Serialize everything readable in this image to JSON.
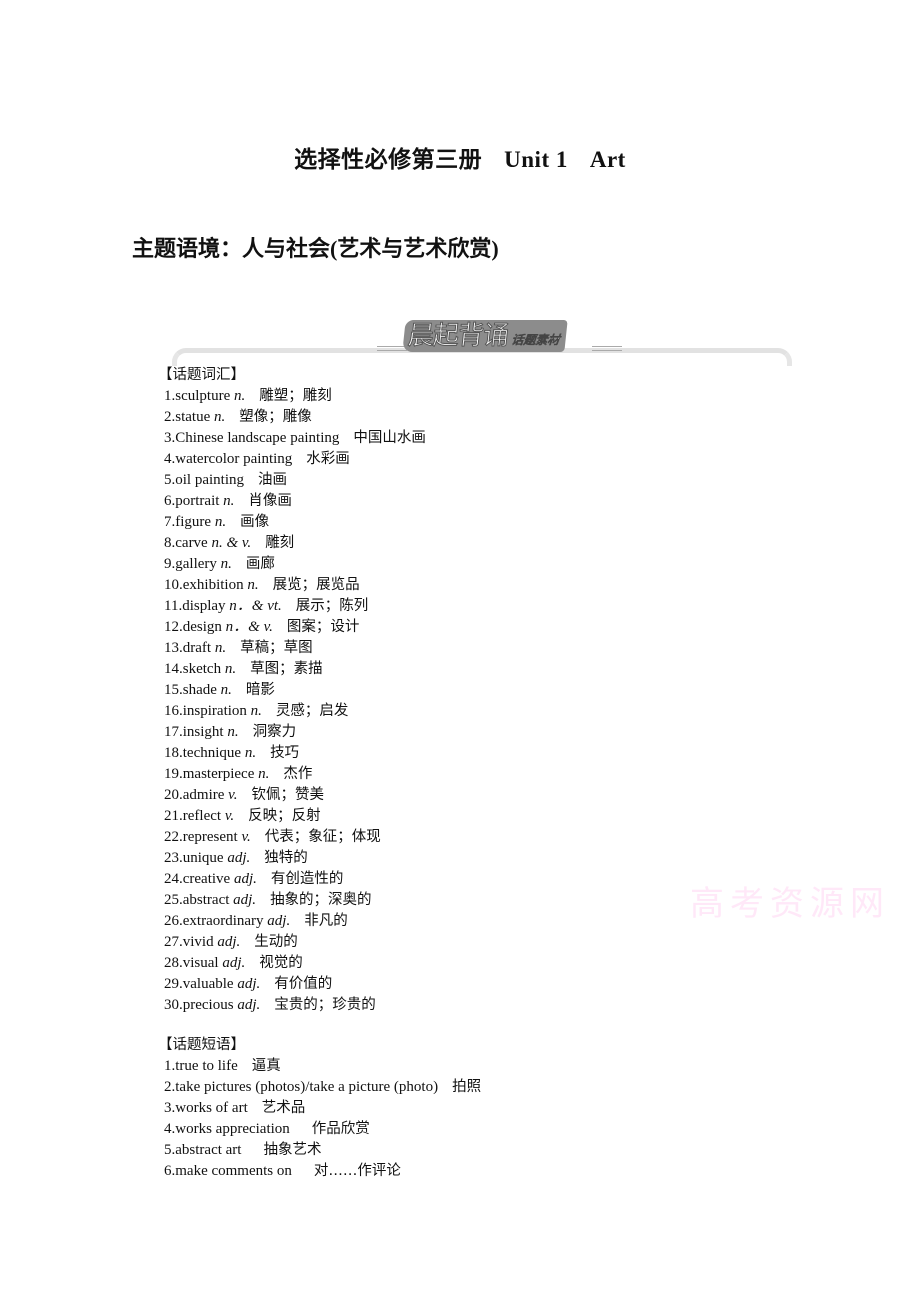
{
  "header": {
    "title_cn": "选择性必修第三册",
    "title_unit": "Unit 1",
    "title_topic": "Art",
    "theme": "主题语境：人与社会(艺术与艺术欣赏)"
  },
  "banner": {
    "main": "晨起背诵",
    "sub": "话题素材"
  },
  "vocabulary": {
    "heading": "【话题词汇】",
    "items": [
      {
        "num": "1.",
        "word": "sculpture",
        "pos": "n.",
        "meaning": "雕塑；雕刻"
      },
      {
        "num": "2.",
        "word": "statue",
        "pos": "n.",
        "meaning": "塑像；雕像"
      },
      {
        "num": "3.",
        "word": "Chinese landscape painting",
        "pos": "",
        "meaning": "中国山水画"
      },
      {
        "num": "4.",
        "word": "watercolor painting",
        "pos": "",
        "meaning": "水彩画"
      },
      {
        "num": "5.",
        "word": "oil painting",
        "pos": "",
        "meaning": "油画"
      },
      {
        "num": "6.",
        "word": "portrait",
        "pos": "n.",
        "meaning": "肖像画"
      },
      {
        "num": "7.",
        "word": "figure",
        "pos": "n.",
        "meaning": "画像"
      },
      {
        "num": "8.",
        "word": "carve",
        "pos": "n. & v.",
        "meaning": "雕刻"
      },
      {
        "num": "9.",
        "word": "gallery",
        "pos": "n.",
        "meaning": "画廊"
      },
      {
        "num": "10.",
        "word": "exhibition",
        "pos": "n.",
        "meaning": "展览；展览品"
      },
      {
        "num": "11.",
        "word": "display",
        "pos": "n．& vt.",
        "meaning": "展示；陈列"
      },
      {
        "num": "12.",
        "word": "design",
        "pos": "n．& v.",
        "meaning": "图案；设计"
      },
      {
        "num": "13.",
        "word": "draft",
        "pos": "n.",
        "meaning": "草稿；草图"
      },
      {
        "num": "14.",
        "word": "sketch",
        "pos": "n.",
        "meaning": "草图；素描"
      },
      {
        "num": "15.",
        "word": "shade",
        "pos": "n.",
        "meaning": "暗影"
      },
      {
        "num": "16.",
        "word": "inspiration",
        "pos": "n.",
        "meaning": "灵感；启发"
      },
      {
        "num": "17.",
        "word": "insight",
        "pos": "n.",
        "meaning": "洞察力"
      },
      {
        "num": "18.",
        "word": "technique",
        "pos": "n.",
        "meaning": "技巧"
      },
      {
        "num": "19.",
        "word": "masterpiece",
        "pos": "n.",
        "meaning": "杰作"
      },
      {
        "num": "20.",
        "word": "admire",
        "pos": "v.",
        "meaning": "钦佩；赞美"
      },
      {
        "num": "21.",
        "word": "reflect",
        "pos": "v.",
        "meaning": "反映；反射"
      },
      {
        "num": "22.",
        "word": "represent",
        "pos": "v.",
        "meaning": "代表；象征；体现"
      },
      {
        "num": "23.",
        "word": "unique",
        "pos": "adj.",
        "meaning": "独特的"
      },
      {
        "num": "24.",
        "word": "creative",
        "pos": "adj.",
        "meaning": "有创造性的"
      },
      {
        "num": "25.",
        "word": "abstract",
        "pos": "adj.",
        "meaning": "抽象的；深奥的"
      },
      {
        "num": "26.",
        "word": "extraordinary",
        "pos": "adj.",
        "meaning": "非凡的"
      },
      {
        "num": "27.",
        "word": "vivid",
        "pos": "adj.",
        "meaning": "生动的"
      },
      {
        "num": "28.",
        "word": "visual",
        "pos": "adj.",
        "meaning": "视觉的"
      },
      {
        "num": "29.",
        "word": "valuable",
        "pos": "adj.",
        "meaning": "有价值的"
      },
      {
        "num": "30.",
        "word": "precious",
        "pos": "adj.",
        "meaning": "宝贵的；珍贵的"
      }
    ]
  },
  "phrases": {
    "heading": "【话题短语】",
    "items": [
      {
        "num": "1.",
        "phrase": "true to life",
        "meaning": "逼真"
      },
      {
        "num": "2.",
        "phrase": "take pictures (photos)/take a picture (photo)",
        "meaning": "拍照"
      },
      {
        "num": "3.",
        "phrase": "works of art",
        "meaning": "艺术品"
      },
      {
        "num": "4.",
        "phrase": "works appreciation",
        "meaning": "作品欣赏"
      },
      {
        "num": "5.",
        "phrase": "abstract art",
        "meaning": "抽象艺术"
      },
      {
        "num": "6.",
        "phrase": "make comments on",
        "meaning": "对……作评论"
      }
    ]
  },
  "watermark": "高考资源网"
}
